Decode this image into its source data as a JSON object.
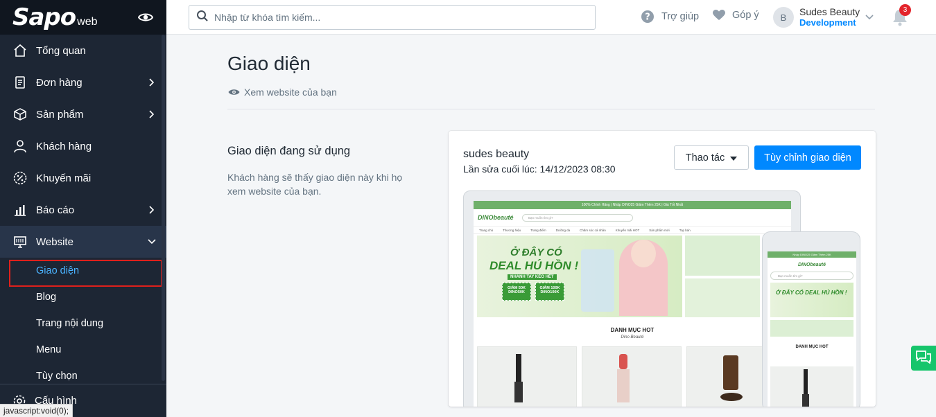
{
  "brand": {
    "logo_main": "Sapo",
    "logo_sub": "web"
  },
  "sidebar": {
    "items": [
      {
        "label": "Tổng quan",
        "icon": "home-icon",
        "has_arrow": false
      },
      {
        "label": "Đơn hàng",
        "icon": "receipt-icon",
        "has_arrow": true
      },
      {
        "label": "Sản phẩm",
        "icon": "box-icon",
        "has_arrow": true
      },
      {
        "label": "Khách hàng",
        "icon": "user-icon",
        "has_arrow": false
      },
      {
        "label": "Khuyến mãi",
        "icon": "percent-icon",
        "has_arrow": false
      },
      {
        "label": "Báo cáo",
        "icon": "chart-icon",
        "has_arrow": true
      },
      {
        "label": "Website",
        "icon": "monitor-icon",
        "has_arrow": true,
        "expanded": true
      }
    ],
    "website_subitems": [
      "Giao diện",
      "Blog",
      "Trang nội dung",
      "Menu",
      "Tùy chọn"
    ],
    "bottom_item": "Cấu hình",
    "status_tip": "javascript:void(0);"
  },
  "header": {
    "search_placeholder": "Nhập từ khóa tìm kiếm...",
    "help": "Trợ giúp",
    "feedback": "Góp ý",
    "user_initial": "B",
    "user_name": "Sudes Beauty",
    "user_role": "Development",
    "notification_count": "3"
  },
  "main": {
    "title": "Giao diện",
    "view_site": "Xem website của bạn",
    "section_title": "Giao diện đang sử dụng",
    "section_desc": "Khách hàng sẽ thấy giao diện này khi họ xem website của bạn.",
    "theme": {
      "name": "sudes beauty",
      "last_edited": "Lần sửa cuối lúc: 14/12/2023 08:30",
      "actions_label": "Thao tác",
      "customize_label": "Tùy chỉnh giao diện"
    },
    "preview": {
      "top_bar": "100% Chính Hãng   |   Nhập DINO25 Giảm Thêm 25K   |   Giá Tốt Nhất",
      "logo": "DINObeauté",
      "search": "Bạn muốn tìm gì?",
      "nav": [
        "Trang chủ",
        "Thương hiệu",
        "Trang điểm",
        "Dưỡng da",
        "Chăm sóc cá nhân",
        "Khuyến mãi HOT",
        "Sản phẩm mới",
        "Top bán"
      ],
      "banner_line1": "Ở ĐÂY CÓ",
      "banner_line2": "DEAL HÚ HỒN !",
      "banner_line3": "NHANH TAY KÉO HẾT",
      "coupon1": "GIẢM 50K DINO50K",
      "coupon2": "GIẢM 100K DINO100K",
      "hot_title": "DANH MỤC HOT",
      "hot_sub": "Dino Beauté",
      "mobile_top": "Nhập DINO25 Giảm Thêm 25K",
      "mobile_banner": "Ở ĐÂY CÓ DEAL HÚ HỒN !",
      "mobile_hot": "DANH MỤC HOT"
    }
  },
  "colors": {
    "sidebar": "#1d2634",
    "accent": "#0088ff",
    "highlight": "#e0201b",
    "chat": "#16c56c"
  }
}
